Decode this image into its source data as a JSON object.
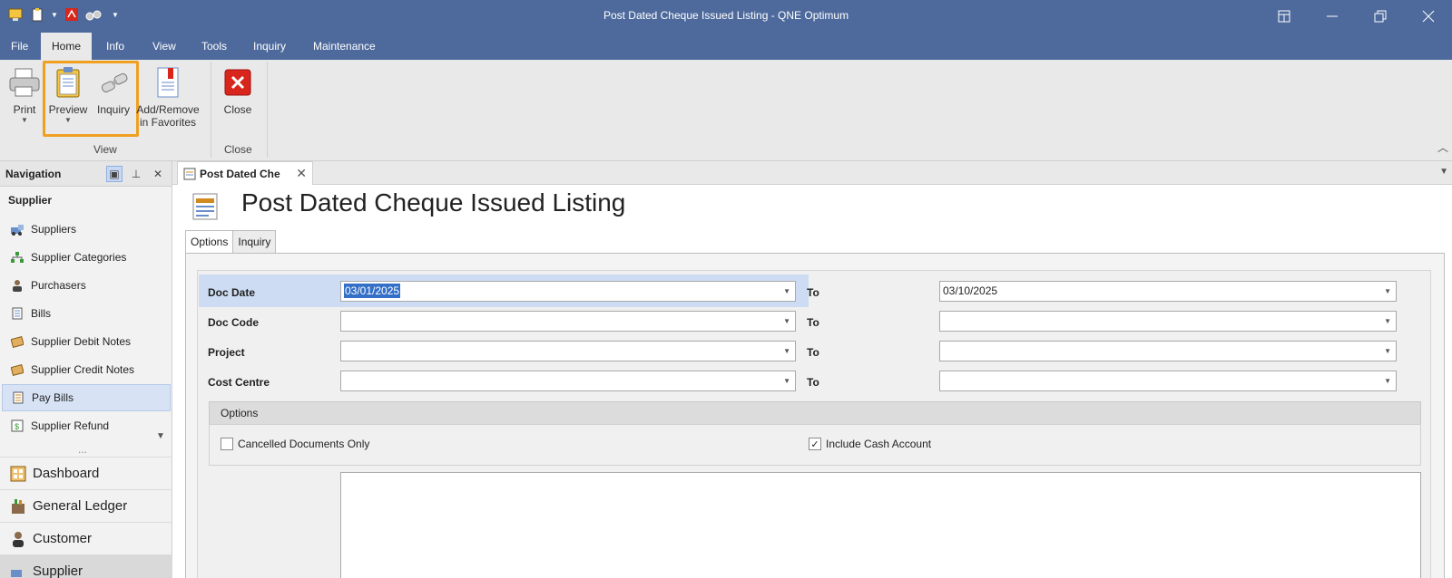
{
  "window": {
    "title": "Post Dated Cheque Issued Listing - QNE Optimum",
    "controls": [
      "layout-icon",
      "minimize-icon",
      "restore-icon",
      "close-icon"
    ]
  },
  "menu": {
    "tabs": [
      "File",
      "Home",
      "Info",
      "View",
      "Tools",
      "Inquiry",
      "Maintenance"
    ],
    "active": "Home"
  },
  "ribbon": {
    "print": "Print",
    "preview": "Preview",
    "inquiry": "Inquiry",
    "favorites_line1": "Add/Remove",
    "favorites_line2": "in Favorites",
    "close": "Close",
    "group_view": "View",
    "group_close": "Close"
  },
  "nav": {
    "header": "Navigation",
    "section": "Supplier",
    "items": [
      {
        "label": "Suppliers",
        "icon": "suppliers-icon"
      },
      {
        "label": "Supplier Categories",
        "icon": "categories-icon"
      },
      {
        "label": "Purchasers",
        "icon": "person-icon"
      },
      {
        "label": "Bills",
        "icon": "bill-icon"
      },
      {
        "label": "Supplier Debit Notes",
        "icon": "debit-note-icon"
      },
      {
        "label": "Supplier Credit Notes",
        "icon": "credit-note-icon"
      },
      {
        "label": "Pay Bills",
        "icon": "pay-bills-icon"
      },
      {
        "label": "Supplier Refund",
        "icon": "refund-icon"
      }
    ],
    "active_item": "Pay Bills",
    "more": "...",
    "modules": [
      "Dashboard",
      "General Ledger",
      "Customer",
      "Supplier"
    ]
  },
  "doc_tab": {
    "label": "Post Dated Che "
  },
  "page": {
    "title": "Post Dated Cheque Issued Listing",
    "tabs": [
      "Options",
      "Inquiry"
    ],
    "active_tab": "Options"
  },
  "form": {
    "to_label": "To",
    "rows": [
      {
        "label": "Doc Date",
        "from": "03/01/2025",
        "to": "03/10/2025"
      },
      {
        "label": "Doc Code",
        "from": "",
        "to": ""
      },
      {
        "label": "Project",
        "from": "",
        "to": ""
      },
      {
        "label": "Cost Centre",
        "from": "",
        "to": ""
      }
    ],
    "options_header": "Options",
    "cancelled_only": {
      "label": "Cancelled Documents Only",
      "checked": false
    },
    "include_cash": {
      "label": "Include Cash Account",
      "checked": true
    }
  },
  "colors": {
    "titlebar": "#4e6a9c",
    "highlight": "#f0a020",
    "selection": "#3470c8"
  }
}
